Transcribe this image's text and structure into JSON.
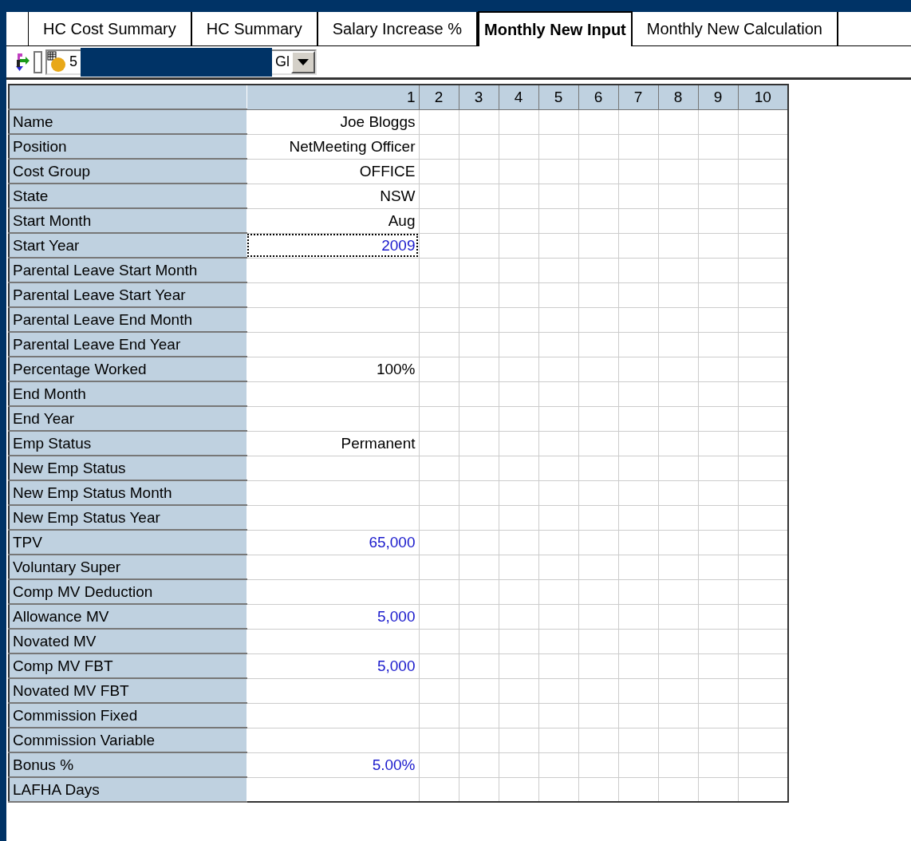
{
  "tabs": [
    {
      "label": "HC Cost Summary",
      "selected": false
    },
    {
      "label": "HC Summary",
      "selected": false
    },
    {
      "label": "Salary Increase %",
      "selected": false
    },
    {
      "label": "Monthly New Input",
      "selected": true
    },
    {
      "label": "Monthly New Calculation",
      "selected": false
    }
  ],
  "toolbar": {
    "dropdown": {
      "value_start": "5",
      "value_end": "Gl"
    }
  },
  "table": {
    "columns": [
      "1",
      "2",
      "3",
      "4",
      "5",
      "6",
      "7",
      "8",
      "9",
      "10"
    ],
    "rows": [
      {
        "label": "Name",
        "value": "Joe Bloggs",
        "kind": "text",
        "selected": false
      },
      {
        "label": "Position",
        "value": "NetMeeting Officer",
        "kind": "text",
        "selected": false
      },
      {
        "label": "Cost Group",
        "value": "OFFICE",
        "kind": "text",
        "selected": false
      },
      {
        "label": "State",
        "value": "NSW",
        "kind": "text",
        "selected": false
      },
      {
        "label": "Start Month",
        "value": "Aug",
        "kind": "text",
        "selected": false
      },
      {
        "label": "Start Year",
        "value": "2009",
        "kind": "input",
        "selected": true
      },
      {
        "label": "Parental Leave Start Month",
        "selected": false
      },
      {
        "label": "Parental Leave Start Year",
        "selected": false
      },
      {
        "label": "Parental Leave End Month",
        "selected": false
      },
      {
        "label": "Parental Leave End Year",
        "selected": false
      },
      {
        "label": "Percentage Worked",
        "value": "100%",
        "kind": "text",
        "selected": false
      },
      {
        "label": "End Month",
        "selected": false
      },
      {
        "label": "End Year",
        "selected": false
      },
      {
        "label": "Emp Status",
        "value": "Permanent",
        "kind": "text",
        "selected": false
      },
      {
        "label": "New Emp Status",
        "selected": false
      },
      {
        "label": "New Emp Status Month",
        "selected": false
      },
      {
        "label": "New Emp Status Year",
        "selected": false
      },
      {
        "label": "TPV",
        "value": "65,000",
        "kind": "input",
        "selected": false
      },
      {
        "label": "Voluntary Super",
        "selected": false
      },
      {
        "label": "Comp MV Deduction",
        "selected": false
      },
      {
        "label": "Allowance MV",
        "value": "5,000",
        "kind": "input",
        "selected": false
      },
      {
        "label": "Novated MV",
        "selected": false
      },
      {
        "label": "Comp MV FBT",
        "value": "5,000",
        "kind": "input",
        "selected": false
      },
      {
        "label": "Novated MV FBT",
        "selected": false
      },
      {
        "label": "Commission Fixed",
        "selected": false
      },
      {
        "label": "Commission Variable",
        "selected": false
      },
      {
        "label": "Bonus %",
        "value": "5.00%",
        "kind": "input",
        "selected": false
      },
      {
        "label": "LAFHA Days",
        "selected": false
      }
    ]
  }
}
